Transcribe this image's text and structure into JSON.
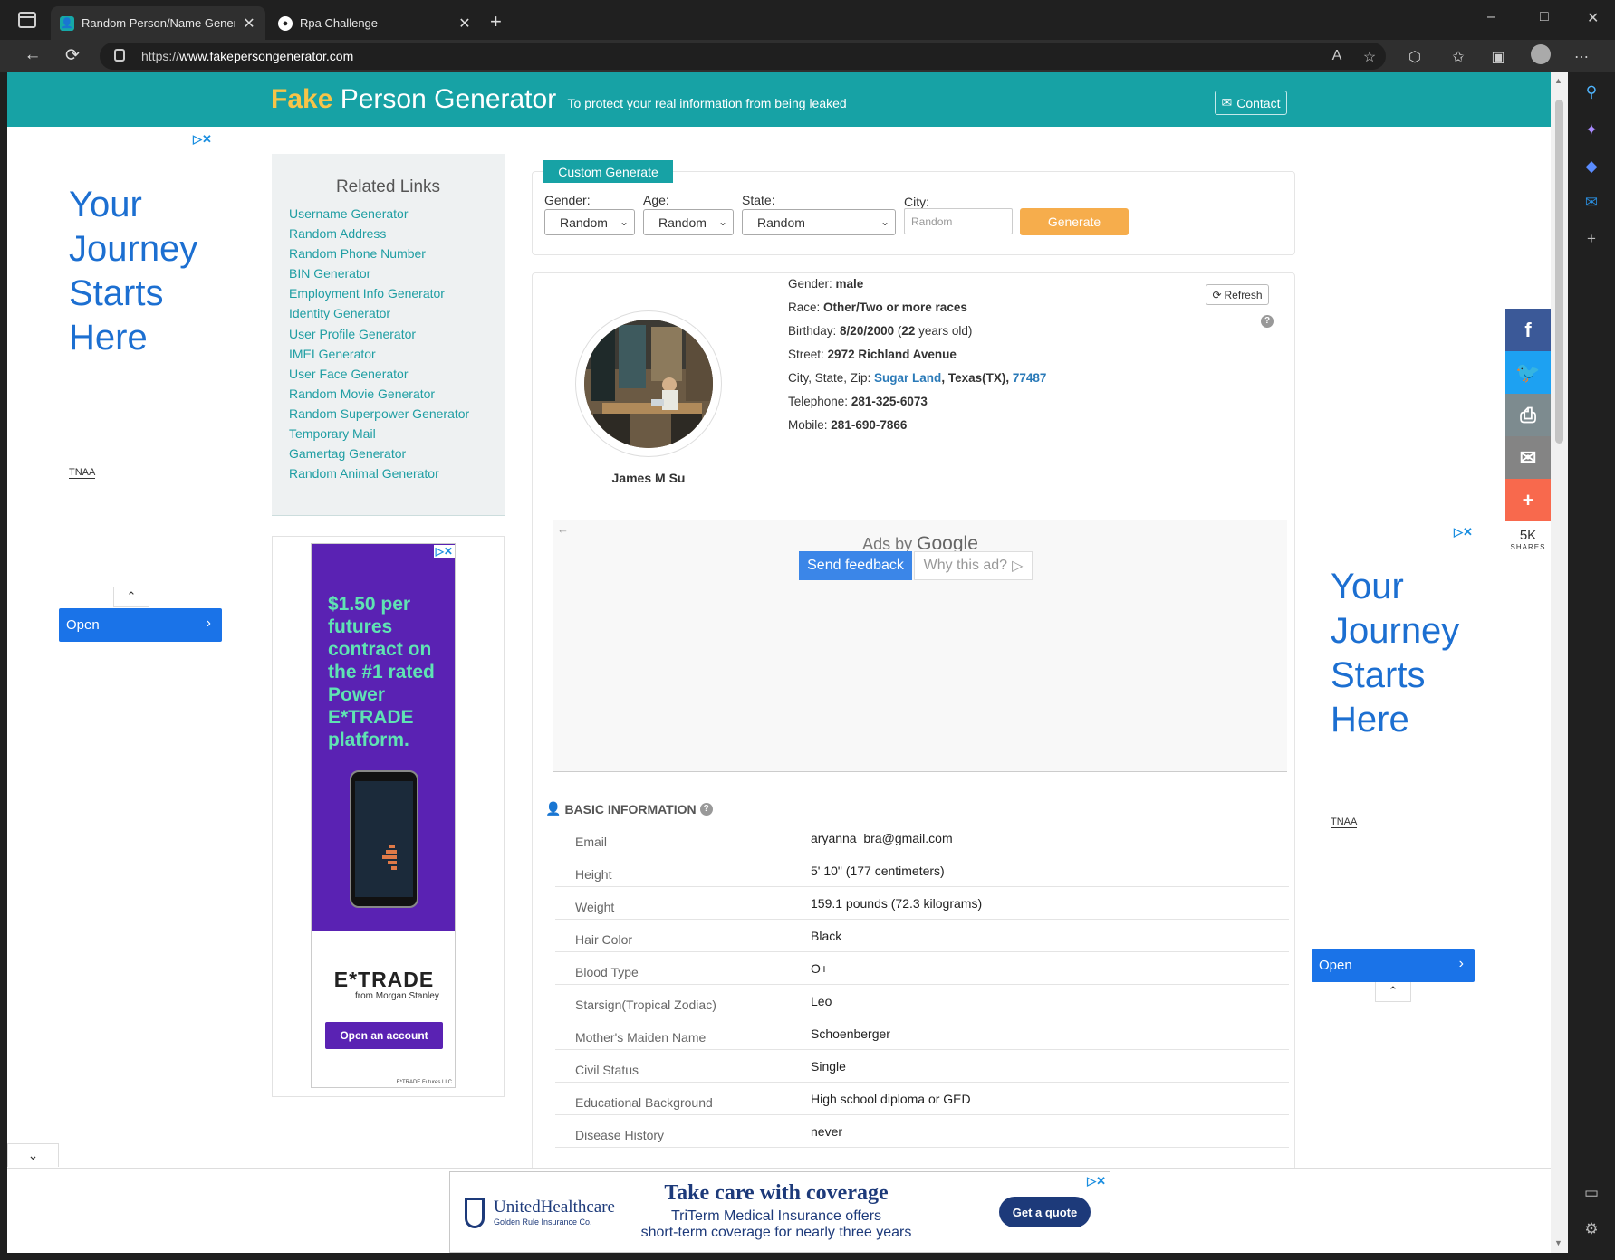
{
  "browser": {
    "tabs": [
      {
        "title": "Random Person/Name Generator",
        "icon": "person-favicon",
        "active": true
      },
      {
        "title": "Rpa Challenge",
        "icon": "robot-favicon",
        "active": false
      }
    ],
    "url_scheme": "https://",
    "url_host": "www.fakepersongenerator.com",
    "icons": {
      "new_tab": "+",
      "minimize": "–",
      "maximize": "□",
      "close": "✕",
      "back": "←",
      "reload": "⟳",
      "more": "⋯"
    }
  },
  "site": {
    "logo_fake": "Fake",
    "logo_rest": "Person Generator",
    "tagline": "To protect your real information from being leaked",
    "contact_label": "Contact"
  },
  "left_ad": {
    "headline": [
      "Your",
      "Journey",
      "Starts",
      "Here"
    ],
    "brand": "TNAA",
    "open_label": "Open"
  },
  "right_ad": {
    "headline": [
      "Your",
      "Journey",
      "Starts",
      "Here"
    ],
    "brand": "TNAA",
    "open_label": "Open"
  },
  "related_links": {
    "title": "Related Links",
    "items": [
      "Username Generator",
      "Random Address",
      "Random Phone Number",
      "BIN Generator",
      "Employment Info Generator",
      "Identity Generator",
      "User Profile Generator",
      "IMEI Generator",
      "User Face Generator",
      "Random Movie Generator",
      "Random Superpower Generator",
      "Temporary Mail",
      "Gamertag Generator",
      "Random Animal Generator"
    ]
  },
  "etrade_ad": {
    "copy": "$1.50 per futures contract on the #1 rated Power E*TRADE platform.",
    "logo": "E*TRADE",
    "sub": "from Morgan Stanley",
    "cta": "Open an account",
    "fine": "E*TRADE Futures LLC"
  },
  "custom_generate": {
    "badge": "Custom Generate",
    "gender_label": "Gender:",
    "gender_value": "Random",
    "age_label": "Age:",
    "age_value": "Random",
    "state_label": "State:",
    "state_value": "Random",
    "city_label": "City:",
    "city_placeholder": "Random",
    "generate_label": "Generate"
  },
  "person": {
    "refresh_label": "Refresh",
    "name": "James M Su",
    "gender_label": "Gender:",
    "gender": "male",
    "race_label": "Race:",
    "race": "Other/Two or more races",
    "birthday_label": "Birthday:",
    "birthday": "8/20/2000",
    "age": "22",
    "age_suffix": "years old)",
    "street_label": "Street:",
    "street": "2972 Richland Avenue",
    "csz_label": "City, State, Zip:",
    "city": "Sugar Land",
    "state": "Texas(TX)",
    "zip": "77487",
    "telephone_label": "Telephone:",
    "telephone": "281-325-6073",
    "mobile_label": "Mobile:",
    "mobile": "281-690-7866"
  },
  "google_ad": {
    "ads_by": "Ads by",
    "google": "Google",
    "send_feedback": "Send feedback",
    "why_this_ad": "Why this ad?"
  },
  "basic_info": {
    "title": "BASIC INFORMATION",
    "rows": [
      {
        "label": "Email",
        "value": "aryanna_bra@gmail.com"
      },
      {
        "label": "Height",
        "value": "5' 10\" (177 centimeters)"
      },
      {
        "label": "Weight",
        "value": "159.1 pounds (72.3 kilograms)"
      },
      {
        "label": "Hair Color",
        "value": "Black"
      },
      {
        "label": "Blood Type",
        "value": "O+"
      },
      {
        "label": "Starsign(Tropical Zodiac)",
        "value": "Leo"
      },
      {
        "label": "Mother's Maiden Name",
        "value": "Schoenberger"
      },
      {
        "label": "Civil Status",
        "value": "Single"
      },
      {
        "label": "Educational Background",
        "value": "High school diploma or GED"
      },
      {
        "label": "Disease History",
        "value": "never"
      }
    ]
  },
  "share": {
    "count": "5K",
    "count_label": "SHARES",
    "colors": {
      "facebook": "#3b5998",
      "twitter": "#1da1f2",
      "print": "#7d8b8f",
      "email": "#848484",
      "more": "#f8694d"
    }
  },
  "bottom_ad": {
    "logo": "UnitedHealthcare",
    "logo_sub": "Golden Rule Insurance Co.",
    "headline": "Take care with coverage",
    "line1": "TriTerm Medical Insurance offers",
    "line2": "short-term coverage for nearly three years",
    "cta": "Get a quote"
  },
  "colors": {
    "brand_teal": "#17a2a5",
    "logo_accent": "#f7c448",
    "generate": "#f6ad4c",
    "link": "#1f9ea3"
  }
}
